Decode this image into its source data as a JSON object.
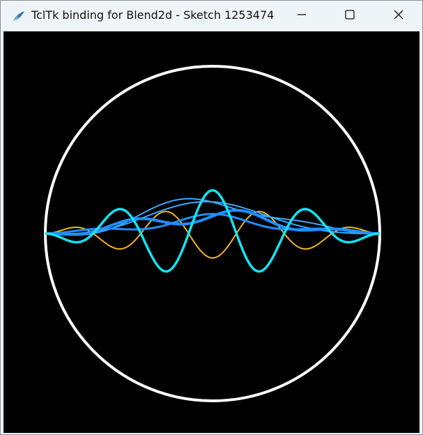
{
  "window": {
    "title": "TclTk binding for Blend2d - Sketch 1253474",
    "icon": "feather-pen-icon",
    "controls": [
      "minimize-icon",
      "maximize-icon",
      "close-icon"
    ]
  },
  "canvas": {
    "background": "#000000",
    "circle_color": "#ffffff",
    "wave_colors": {
      "cyan": "#13e3f2",
      "blue": "#1f8fff",
      "light_blue": "#3aa8ff",
      "orange": "#f5b21e"
    }
  }
}
